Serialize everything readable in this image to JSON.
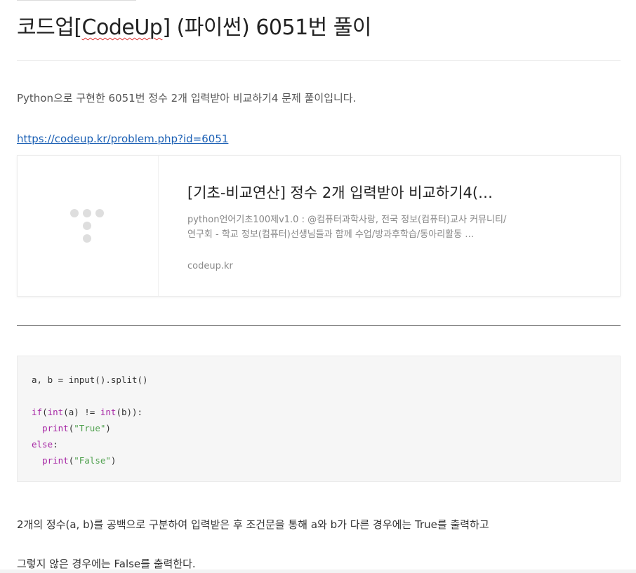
{
  "post": {
    "title_prefix": "코드업",
    "title_bracket_open": "[",
    "title_codeup": "CodeUp",
    "title_suffix": "] (파이썬) 6051번 풀이",
    "intro": "Python으로 구현한 6051번 정수 2개 입력받아 비교하기4 문제 풀이입니다.",
    "link": "https://codeup.kr/problem.php?id=6051"
  },
  "og_card": {
    "title": "[기초-비교연산] 정수 2개 입력받아 비교하기4(…",
    "description": "python언어기초100제v1.0 : @컴퓨터과학사랑, 전국 정보(컴퓨터)교사 커뮤니티/연구회 - 학교 정보(컴퓨터)선생님들과 함께 수업/방과후학습/동아리활동 …",
    "domain": "codeup.kr"
  },
  "code": {
    "line1": "a, b = input().split()",
    "line3_kw": "if",
    "line3_a": "(",
    "line3_int1": "int",
    "line3_b": "(a) != ",
    "line3_int2": "int",
    "line3_c": "(b)):",
    "line4_fn": "print",
    "line4_str": "\"True\"",
    "line5_kw": "else",
    "line5_colon": ":",
    "line6_fn": "print",
    "line6_str": "\"False\""
  },
  "body": {
    "para1": "2개의 정수(a, b)를 공백으로 구분하여 입력받은 후 조건문을 통해 a와 b가 다른 경우에는 True를 출력하고",
    "para2": "그렇지 않은 경우에는 False를 출력한다."
  }
}
